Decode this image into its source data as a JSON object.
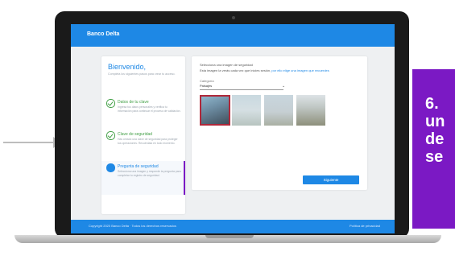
{
  "callout": {
    "text": "6.\nun\nde\nse"
  },
  "app": {
    "logo": "Banco Delta"
  },
  "welcome": {
    "title": "Bienvenido,",
    "desc": "Completa los siguientes pasos para crear tu acceso."
  },
  "steps": [
    {
      "title": "Datos de tu clave",
      "desc": "Ingresa tus datos personales y verifica tu información para continuar el proceso de validación."
    },
    {
      "title": "Clave de seguridad",
      "desc": "Has creado una clave de seguridad para proteger tus operaciones. Recuérdala en todo momento."
    },
    {
      "title": "Pregunta de seguridad",
      "desc": "Selecciona una imagen y responde la pregunta para completar tu registro de seguridad."
    }
  ],
  "form": {
    "question1": "Selecciona una imagen de seguridad",
    "question2_pre": "Esta imagen la verás cada vez que inicies sesión, ",
    "question2_link": "por ello elige una imagen que recuerdes",
    "select_label": "Categoría",
    "select_value": "Paisajes",
    "next_label": "Siguiente"
  },
  "footer": {
    "left": "Copyright 2020 Banco Delta · Todos los derechos reservados",
    "right": "Política de privacidad"
  }
}
